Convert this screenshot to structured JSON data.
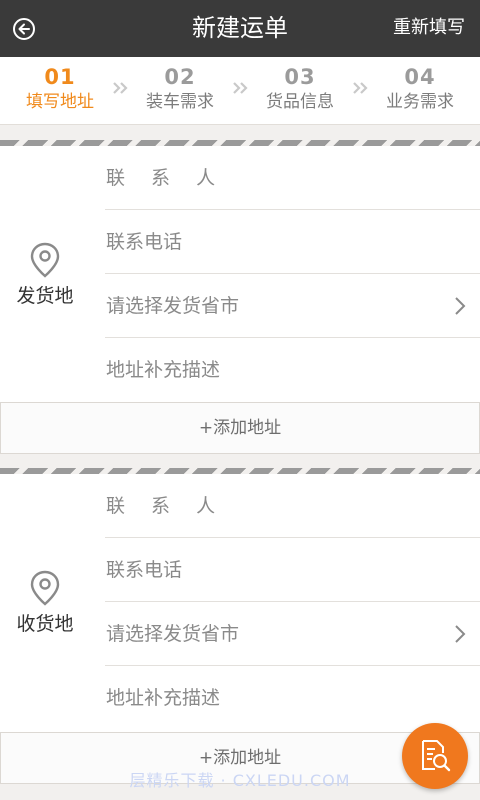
{
  "header": {
    "title": "新建运单",
    "reset_label": "重新填写"
  },
  "steps": [
    {
      "num": "01",
      "label": "填写地址"
    },
    {
      "num": "02",
      "label": "装车需求"
    },
    {
      "num": "03",
      "label": "货品信息"
    },
    {
      "num": "04",
      "label": "业务需求"
    }
  ],
  "sender": {
    "label": "发货地",
    "contact_placeholder": "联 系 人",
    "phone_placeholder": "联系电话",
    "region_placeholder": "请选择发货省市",
    "detail_placeholder": "地址补充描述",
    "add_label": "+添加地址"
  },
  "receiver": {
    "label": "收货地",
    "contact_placeholder": "联 系 人",
    "phone_placeholder": "联系电话",
    "region_placeholder": "请选择发货省市",
    "detail_placeholder": "地址补充描述",
    "add_label": "+添加地址"
  },
  "watermark": "层精乐下载 · CXLEDU.COM",
  "colors": {
    "accent": "#f08a1c",
    "header_bg": "#3a3a3a",
    "fab": "#f0781e"
  },
  "icons": {
    "back": "back-arrow-icon",
    "pin": "location-pin-icon",
    "chevron": "chevron-right-icon",
    "fab": "document-search-icon"
  }
}
